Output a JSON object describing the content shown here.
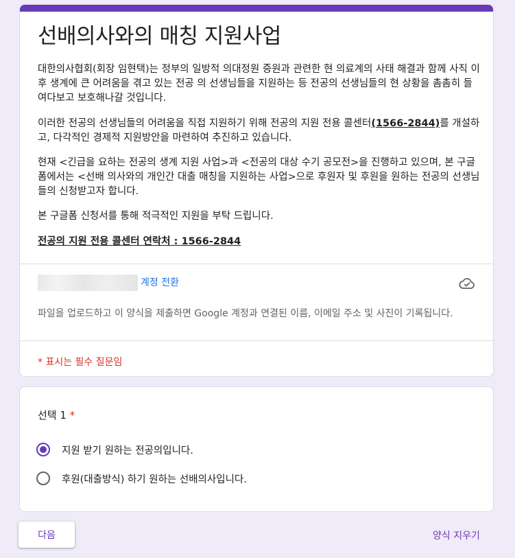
{
  "form": {
    "title": "선배의사와의 매칭 지원사업",
    "description": {
      "p1": "대한의사협회(회장 임현택)는 정부의 일방적 의대정원 증원과 관련한 현 의료계의 사태 해결과 함께 사직 이후 생계에 큰 어려움을 겪고 있는 전공 의 선생님들을 지원하는 등 전공의 선생님들의 현 상황을 촘촘히 들여다보고 보호해나갈 것입니다.",
      "p2_before": "이러한 전공의 선생님들의 어려움을 직접 지원하기 위해 전공의 지원 전용 콜센터",
      "p2_phone": "(1566-2844)",
      "p2_after": "를 개설하고, 다각적인 경제적 지원방안을 마련하여 추진하고 있습니다.",
      "p3": "현재 <긴급을 요하는 전공의 생계 지원 사업>과 <전공의 대상 수기 공모전>을 진행하고 있으며, 본 구글폼에서는 <선배 의사와의 개인간 대출 매칭을 지원하는 사업>으로 후원자 및 후원을 원하는 전공의 선생님들의 신청받고자 합니다.",
      "p4": "본 구글폼 신청서를 통해 적극적인 지원을 부탁 드립니다.",
      "contact": "전공의 지원 전용 콜센터 연락처 : 1566-2844"
    },
    "account": {
      "switch_label": "계정 전환",
      "cloud_icon": "cloud-saved-icon"
    },
    "notice": "파일을 업로드하고 이 양식을 제출하면 Google 계정과 연결된 이름, 이메일 주소 및 사진이 기록됩니다.",
    "required_note": "* 표시는 필수 질문임"
  },
  "question": {
    "title": "선택 1",
    "required_mark": "*",
    "options": [
      {
        "label": "지원 받기 원하는 전공의입니다.",
        "selected": true
      },
      {
        "label": "후원(대출방식) 하기 원하는 선배의사입니다.",
        "selected": false
      }
    ]
  },
  "footer": {
    "next_label": "다음",
    "clear_label": "양식 지우기"
  },
  "colors": {
    "background": "#f0ebf8",
    "accent": "#673ab7",
    "link": "#1a73e8",
    "required": "#d93025"
  }
}
